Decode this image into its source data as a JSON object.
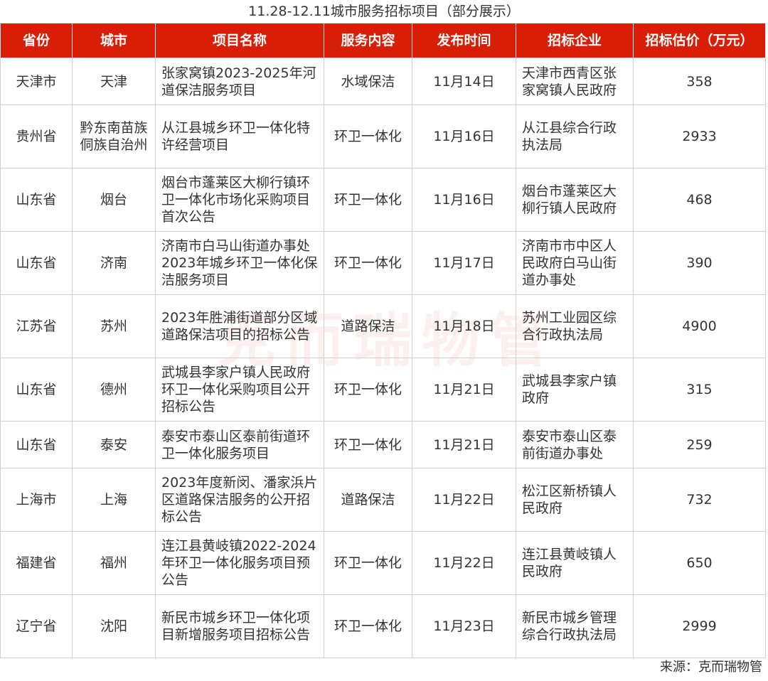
{
  "title": "11.28-12.11城市服务招标项目（部分展示）",
  "watermark": "克而瑞物管",
  "source": "来源：克而瑞物管",
  "columns": [
    "省份",
    "城市",
    "项目名称",
    "服务内容",
    "发布时间",
    "招标企业",
    "招标估价（万元）"
  ],
  "rows": [
    {
      "province": "天津市",
      "city": "天津",
      "name": "张家窝镇2023-2025年河道保洁服务项目",
      "service": "水域保洁",
      "date": "11月14日",
      "company": "天津市西青区张家窝镇人民政府",
      "price": "358"
    },
    {
      "province": "贵州省",
      "city": "黔东南苗族侗族自治州",
      "name": "从江县城乡环卫一体化特许经营项目",
      "service": "环卫一体化",
      "date": "11月16日",
      "company": "从江县综合行政执法局",
      "price": "2933"
    },
    {
      "province": "山东省",
      "city": "烟台",
      "name": "烟台市蓬莱区大柳行镇环卫一体化市场化采购项目首次公告",
      "service": "环卫一体化",
      "date": "11月16日",
      "company": "烟台市蓬莱区大柳行镇人民政府",
      "price": "468"
    },
    {
      "province": "山东省",
      "city": "济南",
      "name": "济南市白马山街道办事处2023年城乡环卫一体化保洁服务项目",
      "service": "环卫一体化",
      "date": "11月17日",
      "company": "济南市市中区人民政府白马山街道办事处",
      "price": "390"
    },
    {
      "province": "江苏省",
      "city": "苏州",
      "name": "2023年胜浦街道部分区域道路保洁项目的招标公告",
      "service": "道路保洁",
      "date": "11月18日",
      "company": "苏州工业园区综合行政执法局",
      "price": "4900"
    },
    {
      "province": "山东省",
      "city": "德州",
      "name": "武城县李家户镇人民政府环卫一体化采购项目公开招标公告",
      "service": "环卫一体化",
      "date": "11月21日",
      "company": "武城县李家户镇政府",
      "price": "315"
    },
    {
      "province": "山东省",
      "city": "泰安",
      "name": "泰安市泰山区泰前街道环卫一体化服务项目",
      "service": "环卫一体化",
      "date": "11月21日",
      "company": "泰安市泰山区泰前街道办事处",
      "price": "259"
    },
    {
      "province": "上海市",
      "city": "上海",
      "name": "2023年度新闵、潘家浜片区道路保洁服务的公开招标公告",
      "service": "道路保洁",
      "date": "11月22日",
      "company": "松江区新桥镇人民政府",
      "price": "732"
    },
    {
      "province": "福建省",
      "city": "福州",
      "name": "连江县黄岐镇2022-2024年环卫一体化服务项目预公告",
      "service": "环卫一体化",
      "date": "11月22日",
      "company": "连江县黄岐镇人民政府",
      "price": "650"
    },
    {
      "province": "辽宁省",
      "city": "沈阳",
      "name": "新民市城乡环卫一体化项目新增服务项目招标公告",
      "service": "环卫一体化",
      "date": "11月23日",
      "company": "新民市城乡管理综合行政执法局",
      "price": "2999"
    }
  ]
}
